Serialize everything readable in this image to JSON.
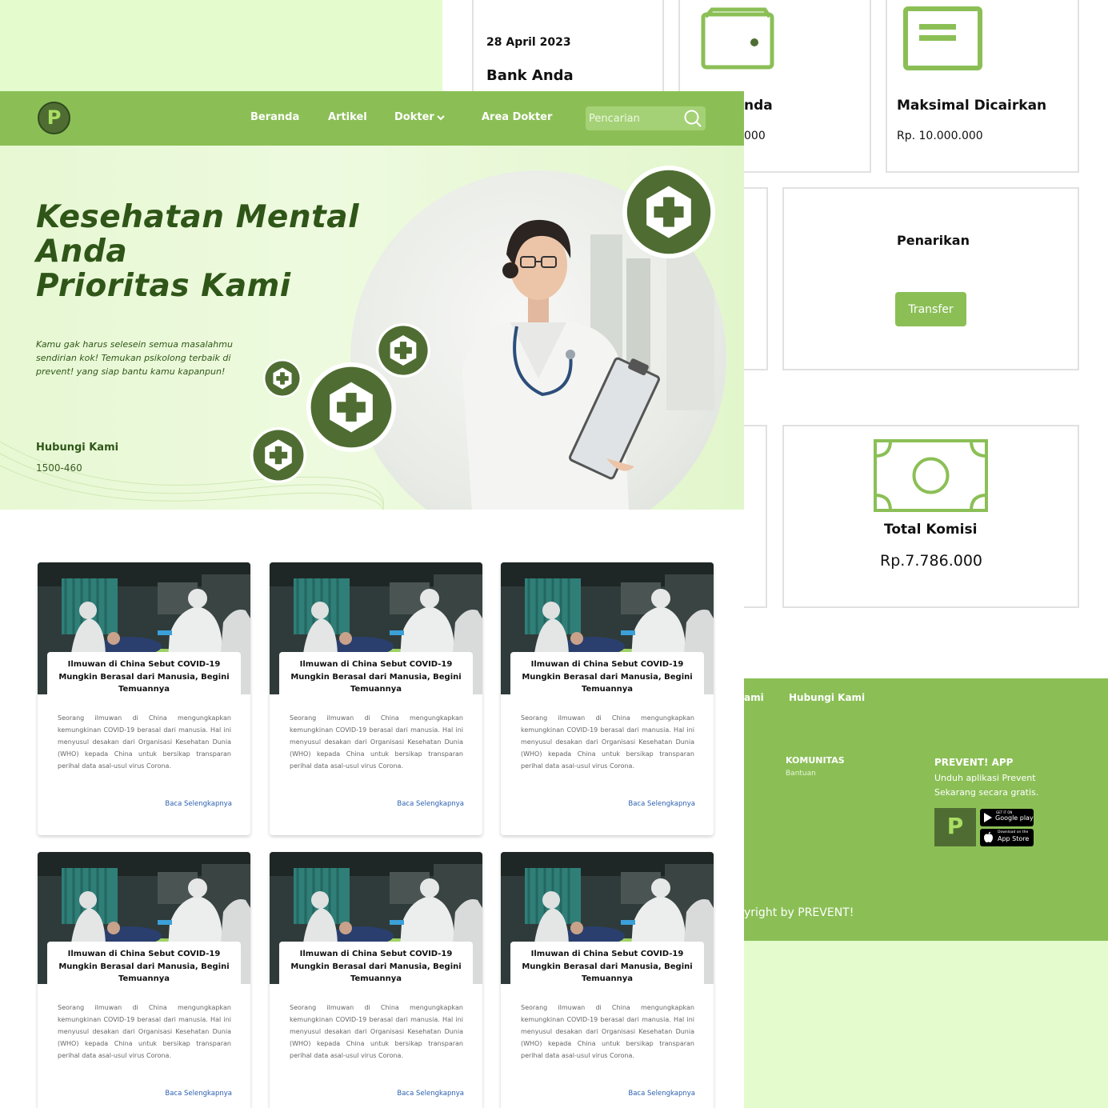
{
  "dashboard": {
    "date": "28 April 2023",
    "bank_title": "Bank Anda",
    "saldo_partial_title": "nda",
    "saldo_partial_value": "000",
    "max_title": "Maksimal Dicairkan",
    "max_value": "Rp. 10.000.000",
    "withdraw_title": "Penarikan",
    "transfer_label": "Transfer",
    "commission_title": "Total Komisi",
    "commission_value": "Rp.7.786.000"
  },
  "nav": {
    "logo_letter": "P",
    "links": [
      "Beranda",
      "Artikel",
      "Dokter",
      "Area Dokter"
    ],
    "search_placeholder": "Pencarian"
  },
  "hero": {
    "title_line1": "Kesehatan Mental",
    "title_line2": "Anda",
    "title_line3": "Prioritas Kami",
    "description": "Kamu gak harus selesein semua masalahmu sendirian kok! Temukan psikolong terbaik di prevent! yang siap bantu kamu kapanpun!",
    "contact_label": "Hubungi Kami",
    "contact_phone": "1500-460"
  },
  "articles": [
    {
      "title": "Ilmuwan di China Sebut COVID-19 Mungkin Berasal dari Manusia, Begini Temuannya",
      "excerpt": "Seorang ilmuwan di China mengungkapkan kemungkinan COVID-19 berasal dari manusia. Hal ini menyusul desakan dari Organisasi Kesehatan Dunia (WHO) kepada China untuk bersikap transparan perihal data asal-usul virus Corona.",
      "read_more": "Baca Selengkapnya"
    },
    {
      "title": "Ilmuwan di China Sebut COVID-19 Mungkin Berasal dari Manusia, Begini Temuannya",
      "excerpt": "Seorang ilmuwan di China mengungkapkan kemungkinan COVID-19 berasal dari manusia. Hal ini menyusul desakan dari Organisasi Kesehatan Dunia (WHO) kepada China untuk bersikap transparan perihal data asal-usul virus Corona.",
      "read_more": "Baca Selengkapnya"
    },
    {
      "title": "Ilmuwan di China Sebut COVID-19 Mungkin Berasal dari Manusia, Begini Temuannya",
      "excerpt": "Seorang ilmuwan di China mengungkapkan kemungkinan COVID-19 berasal dari manusia. Hal ini menyusul desakan dari Organisasi Kesehatan Dunia (WHO) kepada China untuk bersikap transparan perihal data asal-usul virus Corona.",
      "read_more": "Baca Selengkapnya"
    },
    {
      "title": "Ilmuwan di China Sebut COVID-19 Mungkin Berasal dari Manusia, Begini Temuannya",
      "excerpt": "Seorang ilmuwan di China mengungkapkan kemungkinan COVID-19 berasal dari manusia. Hal ini menyusul desakan dari Organisasi Kesehatan Dunia (WHO) kepada China untuk bersikap transparan perihal data asal-usul virus Corona.",
      "read_more": "Baca Selengkapnya"
    },
    {
      "title": "Ilmuwan di China Sebut COVID-19 Mungkin Berasal dari Manusia, Begini Temuannya",
      "excerpt": "Seorang ilmuwan di China mengungkapkan kemungkinan COVID-19 berasal dari manusia. Hal ini menyusul desakan dari Organisasi Kesehatan Dunia (WHO) kepada China untuk bersikap transparan perihal data asal-usul virus Corona.",
      "read_more": "Baca Selengkapnya"
    },
    {
      "title": "Ilmuwan di China Sebut COVID-19 Mungkin Berasal dari Manusia, Begini Temuannya",
      "excerpt": "Seorang ilmuwan di China mengungkapkan kemungkinan COVID-19 berasal dari manusia. Hal ini menyusul desakan dari Organisasi Kesehatan Dunia (WHO) kepada China untuk bersikap transparan perihal data asal-usul virus Corona.",
      "read_more": "Baca Selengkapnya"
    }
  ],
  "footer": {
    "partial_link": "ami",
    "contact_link": "Hubungi Kami",
    "community_title": "KOMUNITAS",
    "community_link": "Bantuan",
    "app_title": "PREVENT! APP",
    "app_line1": "Unduh aplikasi Prevent",
    "app_line2": "Sekarang secara gratis.",
    "google_small": "GET IT ON",
    "google_label": "Google play",
    "apple_small": "Download on the",
    "apple_label": "App Store",
    "copyright_partial": "yright by PREVENT!"
  },
  "colors": {
    "brand_green": "#8bbf56",
    "dark_green": "#2f5618",
    "badge_green": "#4f6d32",
    "light_bg": "#e4fccd",
    "link_blue": "#2b5fb0"
  }
}
